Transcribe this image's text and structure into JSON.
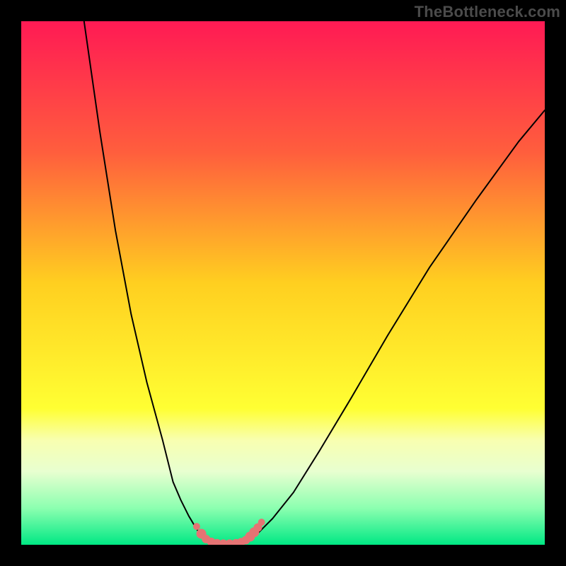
{
  "watermark": "TheBottleneck.com",
  "chart_data": {
    "type": "line",
    "title": "",
    "xlabel": "",
    "ylabel": "",
    "xlim": [
      0,
      100
    ],
    "ylim": [
      0,
      100
    ],
    "grid": false,
    "background_gradient": {
      "stops": [
        {
          "pos": 0.0,
          "color": "#ff1a54"
        },
        {
          "pos": 0.25,
          "color": "#ff5e3d"
        },
        {
          "pos": 0.5,
          "color": "#ffcf20"
        },
        {
          "pos": 0.74,
          "color": "#ffff33"
        },
        {
          "pos": 0.8,
          "color": "#f8ffb0"
        },
        {
          "pos": 0.86,
          "color": "#e8ffd0"
        },
        {
          "pos": 0.93,
          "color": "#8cffb0"
        },
        {
          "pos": 1.0,
          "color": "#00e884"
        }
      ]
    },
    "series": [
      {
        "name": "left-arm",
        "x": [
          12,
          15,
          18,
          21,
          24,
          27,
          29,
          30.5,
          32,
          33.5,
          34.5,
          35.5
        ],
        "y": [
          100,
          79,
          60,
          44,
          31,
          20,
          12,
          8.5,
          5.5,
          3.0,
          1.6,
          0.7
        ]
      },
      {
        "name": "valley-floor",
        "x": [
          35.5,
          37,
          38.5,
          40,
          41.5,
          43
        ],
        "y": [
          0.7,
          0.25,
          0.15,
          0.15,
          0.25,
          0.7
        ]
      },
      {
        "name": "right-arm",
        "x": [
          43,
          45,
          48,
          52,
          57,
          63,
          70,
          78,
          87,
          95,
          100
        ],
        "y": [
          0.7,
          2.0,
          5.0,
          10,
          18,
          28,
          40,
          53,
          66,
          77,
          83
        ]
      }
    ],
    "markers": [
      {
        "x": 33.5,
        "y": 3.5,
        "r": 5
      },
      {
        "x": 34.4,
        "y": 2.1,
        "r": 7
      },
      {
        "x": 35.3,
        "y": 1.1,
        "r": 6
      },
      {
        "x": 36.3,
        "y": 0.55,
        "r": 6
      },
      {
        "x": 37.4,
        "y": 0.3,
        "r": 6
      },
      {
        "x": 38.6,
        "y": 0.22,
        "r": 6
      },
      {
        "x": 39.8,
        "y": 0.22,
        "r": 6
      },
      {
        "x": 41.0,
        "y": 0.3,
        "r": 6
      },
      {
        "x": 42.0,
        "y": 0.5,
        "r": 6
      },
      {
        "x": 42.9,
        "y": 0.9,
        "r": 6
      },
      {
        "x": 43.7,
        "y": 1.55,
        "r": 7
      },
      {
        "x": 44.5,
        "y": 2.4,
        "r": 7
      },
      {
        "x": 45.2,
        "y": 3.3,
        "r": 6
      },
      {
        "x": 45.9,
        "y": 4.3,
        "r": 5
      }
    ],
    "marker_color": "#e57373"
  }
}
